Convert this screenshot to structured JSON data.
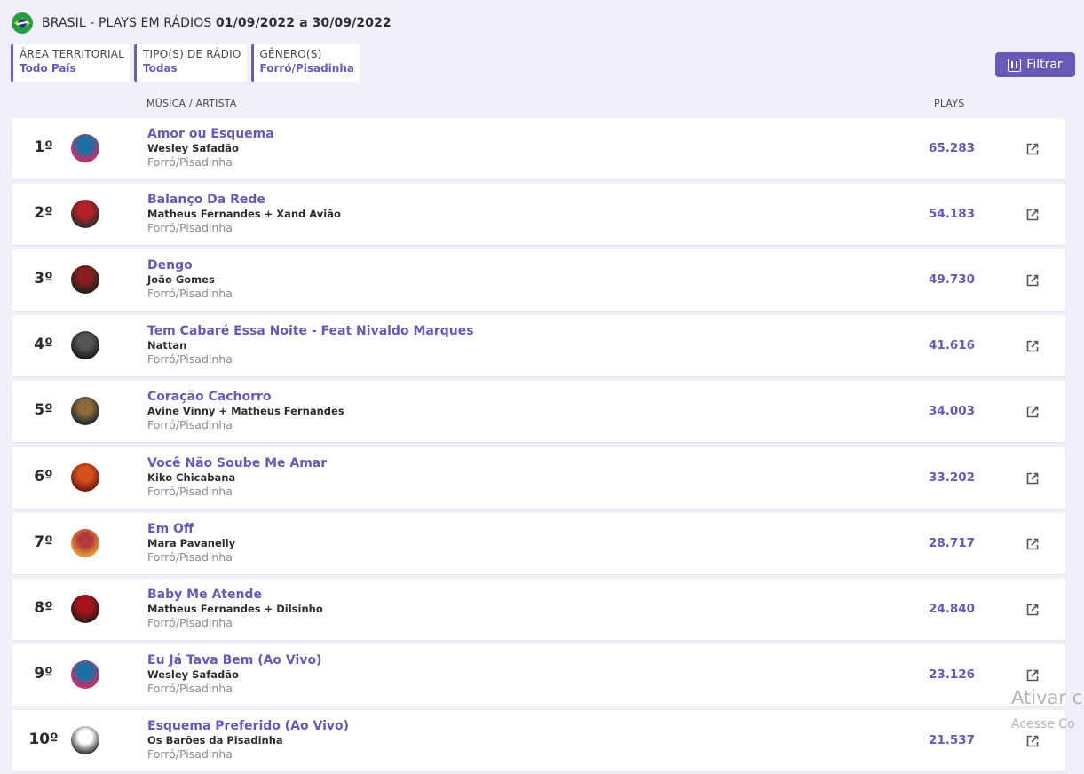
{
  "header": {
    "title_prefix": "BRASIL - PLAYS EM RÁDIOS ",
    "date_range": "01/09/2022 a 30/09/2022"
  },
  "filters": [
    {
      "label": "ÁREA TERRITORIAL",
      "value": "Todo País"
    },
    {
      "label": "TIPO(S) DE RÁDIO",
      "value": "Todas"
    },
    {
      "label": "GÊNERO(S)",
      "value": "Forró/Pisadinha"
    }
  ],
  "filter_button": {
    "label": "Filtrar"
  },
  "columns": {
    "song_artist": "MÚSICA / ARTISTA",
    "plays": "PLAYS"
  },
  "rows": [
    {
      "rank": "1º",
      "song": "Amor ou Esquema",
      "artist": "Wesley Safadão",
      "genre": "Forró/Pisadinha",
      "plays": "65.283"
    },
    {
      "rank": "2º",
      "song": "Balanço Da Rede",
      "artist": "Matheus Fernandes + Xand Avião",
      "genre": "Forró/Pisadinha",
      "plays": "54.183"
    },
    {
      "rank": "3º",
      "song": "Dengo",
      "artist": "João Gomes",
      "genre": "Forró/Pisadinha",
      "plays": "49.730"
    },
    {
      "rank": "4º",
      "song": "Tem Cabaré Essa Noite - Feat Nivaldo Marques",
      "artist": "Nattan",
      "genre": "Forró/Pisadinha",
      "plays": "41.616"
    },
    {
      "rank": "5º",
      "song": "Coração Cachorro",
      "artist": "Avine Vinny + Matheus Fernandes",
      "genre": "Forró/Pisadinha",
      "plays": "34.003"
    },
    {
      "rank": "6º",
      "song": "Você Não Soube Me Amar",
      "artist": "Kiko Chicabana",
      "genre": "Forró/Pisadinha",
      "plays": "33.202"
    },
    {
      "rank": "7º",
      "song": "Em Off",
      "artist": "Mara Pavanelly",
      "genre": "Forró/Pisadinha",
      "plays": "28.717"
    },
    {
      "rank": "8º",
      "song": "Baby Me Atende",
      "artist": "Matheus Fernandes + Dilsinho",
      "genre": "Forró/Pisadinha",
      "plays": "24.840"
    },
    {
      "rank": "9º",
      "song": "Eu Já Tava Bem (Ao Vivo)",
      "artist": "Wesley Safadão",
      "genre": "Forró/Pisadinha",
      "plays": "23.126"
    },
    {
      "rank": "10º",
      "song": "Esquema Preferido (Ao Vivo)",
      "artist": "Os Barões da Pisadinha",
      "genre": "Forró/Pisadinha",
      "plays": "21.537"
    }
  ],
  "watermark": {
    "line1": "Ativar c",
    "line2": "Acesse Co"
  },
  "colors": {
    "accent": "#6a58b6",
    "background": "#f2effb"
  },
  "icons": {
    "flag": "brazil-flag-icon",
    "filter": "filter-icon",
    "open": "external-link-icon"
  }
}
